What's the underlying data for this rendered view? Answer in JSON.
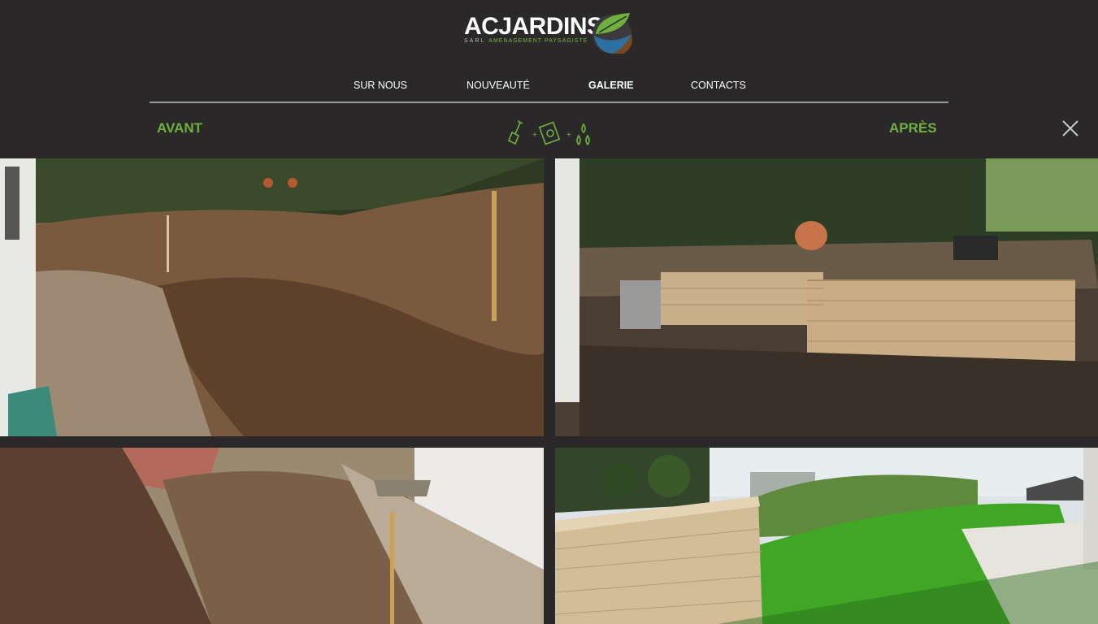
{
  "brand": {
    "name": "ACJARDINS",
    "sarl": "SARL",
    "tagline": "AMENAGEMENT PAYSAGISTE"
  },
  "nav": {
    "items": [
      {
        "label": "SUR NOUS"
      },
      {
        "label": "NOUVEAUTÉ"
      },
      {
        "label": "GALERIE",
        "active": true
      },
      {
        "label": "CONTACTS"
      }
    ]
  },
  "gallery": {
    "before_label": "AVANT",
    "after_label": "APRÈS",
    "photos": [
      {
        "id": "before-1",
        "depicts": "excavated-soil"
      },
      {
        "id": "after-1",
        "depicts": "stone-wall-construction"
      },
      {
        "id": "before-2",
        "depicts": "excavated-slope"
      },
      {
        "id": "after-2",
        "depicts": "finished-lawn-and-wall"
      }
    ]
  },
  "icons": [
    "shovel-icon",
    "seed-icon",
    "water-drops-icon",
    "close-icon",
    "leaf-logo-icon"
  ],
  "colors": {
    "background": "#2a2828",
    "accent_green": "#6fb13f",
    "nav_text": "#ffffff"
  }
}
